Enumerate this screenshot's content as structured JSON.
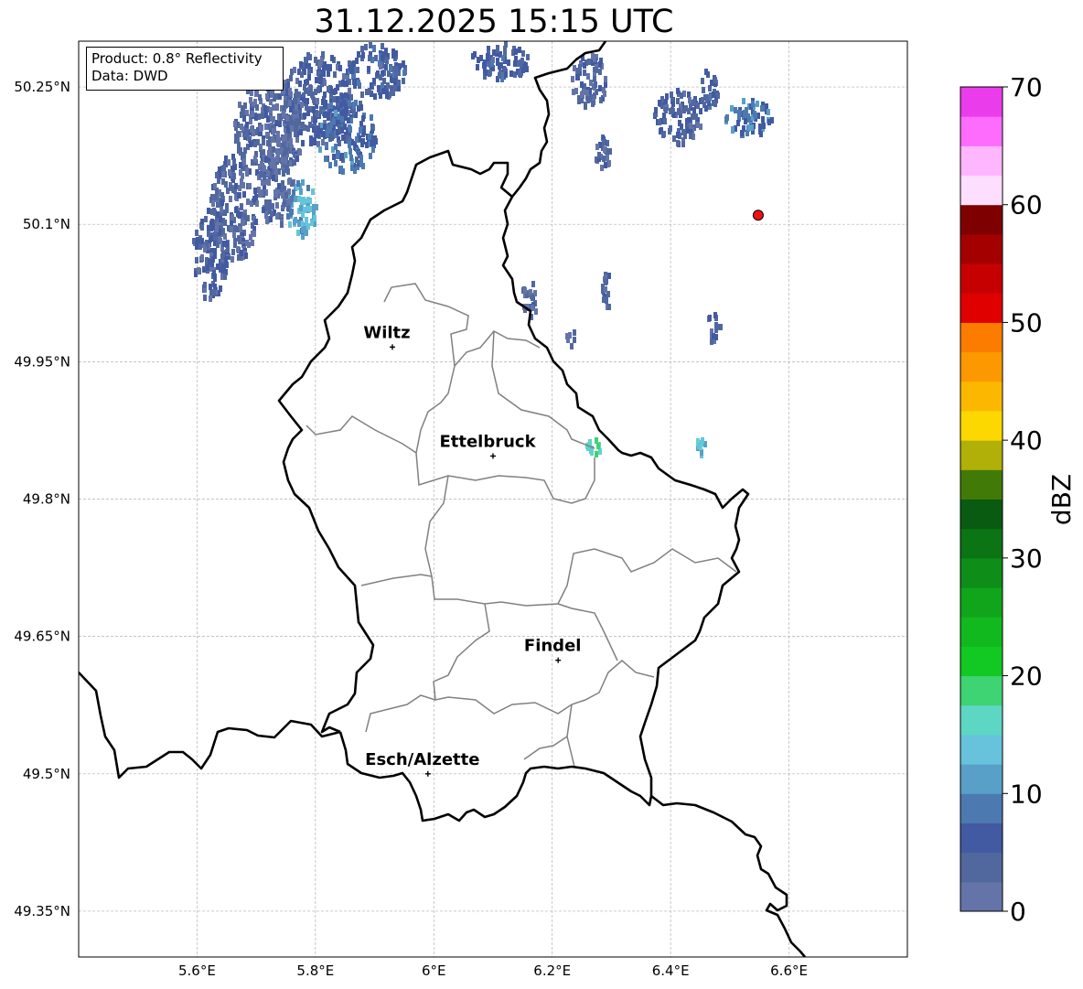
{
  "title": "31.12.2025 15:15 UTC",
  "info": {
    "product_line": "Product: 0.8° Reflectivity",
    "data_line": "Data: DWD"
  },
  "map": {
    "extent": {
      "lon_min": 5.4,
      "lon_max": 6.8,
      "lat_min": 49.3,
      "lat_max": 50.3
    },
    "lat_ticks": [
      {
        "value": 50.25,
        "label": "50.25°N"
      },
      {
        "value": 50.1,
        "label": "50.1°N"
      },
      {
        "value": 49.95,
        "label": "49.95°N"
      },
      {
        "value": 49.8,
        "label": "49.8°N"
      },
      {
        "value": 49.65,
        "label": "49.65°N"
      },
      {
        "value": 49.5,
        "label": "49.5°N"
      },
      {
        "value": 49.35,
        "label": "49.35°N"
      }
    ],
    "lon_ticks": [
      {
        "value": 5.6,
        "label": "5.6°E"
      },
      {
        "value": 5.8,
        "label": "5.8°E"
      },
      {
        "value": 6.0,
        "label": "6°E"
      },
      {
        "value": 6.2,
        "label": "6.2°E"
      },
      {
        "value": 6.4,
        "label": "6.4°E"
      },
      {
        "value": 6.6,
        "label": "6.6°E"
      }
    ],
    "cities": [
      {
        "name": "Wiltz",
        "lon": 5.93,
        "lat": 49.966
      },
      {
        "name": "Ettelbruck",
        "lon": 6.1,
        "lat": 49.847
      },
      {
        "name": "Findel",
        "lon": 6.21,
        "lat": 49.624
      },
      {
        "name": "Esch/Alzette",
        "lon": 5.99,
        "lat": 49.5
      }
    ],
    "radar_site": {
      "lon": 6.548,
      "lat": 50.11,
      "color": "#ee1111"
    },
    "border_color": "#000000",
    "canton_color": "#808080"
  },
  "colorbar": {
    "label": "dBZ",
    "min": 0,
    "max": 70,
    "step": 2.5,
    "ticks": [
      "0",
      "10",
      "20",
      "30",
      "40",
      "50",
      "60",
      "70"
    ],
    "colors": [
      "#6474a8",
      "#51689e",
      "#425aa2",
      "#4d79b1",
      "#58a0c8",
      "#66c3db",
      "#5ed6c4",
      "#3ed373",
      "#12c823",
      "#11b91e",
      "#10a51b",
      "#0e8d18",
      "#0b7414",
      "#085b10",
      "#427a08",
      "#b0b008",
      "#fdd800",
      "#fcb800",
      "#fc9800",
      "#fc7c00",
      "#e00000",
      "#c60000",
      "#a40000",
      "#7e0000",
      "#fedefe",
      "#feb6fe",
      "#fd6cfd",
      "#eb3ceb"
    ]
  },
  "radar_echoes": [
    {
      "lon": 5.72,
      "lat": 50.21,
      "rlon": 0.06,
      "rlat": 0.06,
      "dbz": 4
    },
    {
      "lon": 5.8,
      "lat": 50.24,
      "rlon": 0.06,
      "rlat": 0.05,
      "dbz": 5
    },
    {
      "lon": 5.85,
      "lat": 50.2,
      "rlon": 0.05,
      "rlat": 0.04,
      "dbz": 8
    },
    {
      "lon": 5.9,
      "lat": 50.27,
      "rlon": 0.05,
      "rlat": 0.03,
      "dbz": 6
    },
    {
      "lon": 5.66,
      "lat": 50.12,
      "rlon": 0.04,
      "rlat": 0.06,
      "dbz": 4
    },
    {
      "lon": 5.62,
      "lat": 50.07,
      "rlon": 0.03,
      "rlat": 0.05,
      "dbz": 5
    },
    {
      "lon": 5.77,
      "lat": 50.12,
      "rlon": 0.03,
      "rlat": 0.03,
      "dbz": 12
    },
    {
      "lon": 5.73,
      "lat": 50.15,
      "rlon": 0.03,
      "rlat": 0.05,
      "dbz": 3
    },
    {
      "lon": 6.11,
      "lat": 50.28,
      "rlon": 0.05,
      "rlat": 0.02,
      "dbz": 6
    },
    {
      "lon": 6.26,
      "lat": 50.26,
      "rlon": 0.03,
      "rlat": 0.03,
      "dbz": 4
    },
    {
      "lon": 6.41,
      "lat": 50.22,
      "rlon": 0.04,
      "rlat": 0.03,
      "dbz": 5
    },
    {
      "lon": 6.53,
      "lat": 50.22,
      "rlon": 0.04,
      "rlat": 0.02,
      "dbz": 9
    },
    {
      "lon": 6.46,
      "lat": 50.25,
      "rlon": 0.02,
      "rlat": 0.02,
      "dbz": 6
    },
    {
      "lon": 6.28,
      "lat": 50.18,
      "rlon": 0.015,
      "rlat": 0.02,
      "dbz": 5
    },
    {
      "lon": 6.27,
      "lat": 49.86,
      "rlon": 0.015,
      "rlat": 0.01,
      "dbz": 17
    },
    {
      "lon": 6.45,
      "lat": 49.86,
      "rlon": 0.012,
      "rlat": 0.01,
      "dbz": 14
    },
    {
      "lon": 6.29,
      "lat": 50.03,
      "rlon": 0.01,
      "rlat": 0.02,
      "dbz": 4
    },
    {
      "lon": 6.16,
      "lat": 50.02,
      "rlon": 0.015,
      "rlat": 0.02,
      "dbz": 4
    },
    {
      "lon": 6.47,
      "lat": 49.99,
      "rlon": 0.012,
      "rlat": 0.015,
      "dbz": 4
    },
    {
      "lon": 6.23,
      "lat": 49.98,
      "rlon": 0.008,
      "rlat": 0.01,
      "dbz": 3
    }
  ]
}
